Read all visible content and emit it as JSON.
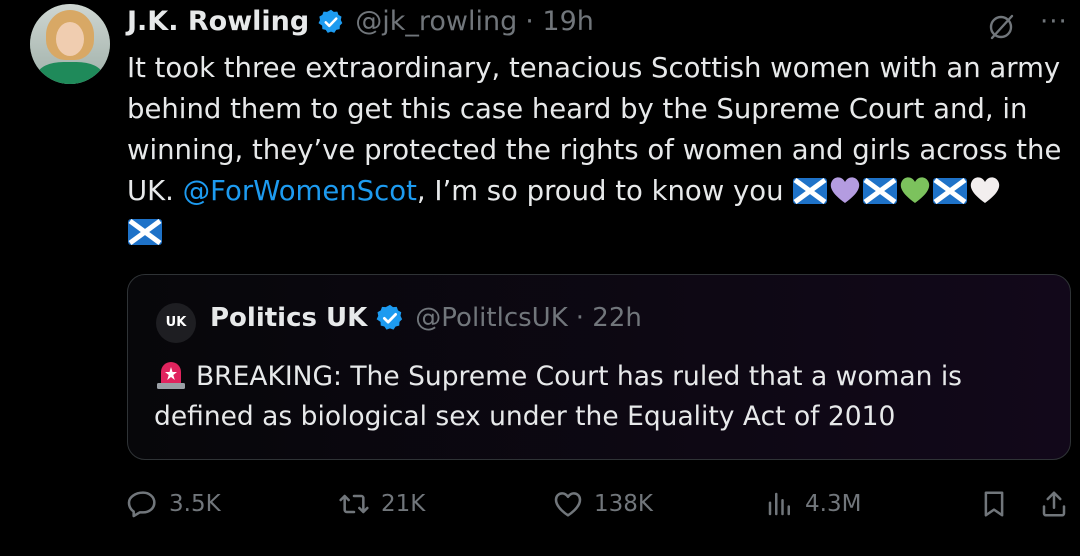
{
  "author": {
    "name": "J.K. Rowling",
    "handle": "@jk_rowling",
    "time": "· 19h",
    "verified_color": "#1d9bf0"
  },
  "tweet": {
    "text_before": "It took three extraordinary, tenacious Scottish women with an army behind them to get this case heard by the Supreme Court and, in winning, they’ve protected the rights of women and girls across the UK. ",
    "mention": "@ForWomenScot",
    "text_after": ", I’m so proud to know you",
    "emojis": [
      "scotland-flag",
      "purple-heart",
      "scotland-flag",
      "green-heart",
      "scotland-flag",
      "white-heart",
      "scotland-flag"
    ]
  },
  "quoted": {
    "avatar_text": "UK",
    "name": "Politics UK",
    "handle": "@PolitlcsUK",
    "time": "· 22h",
    "text": "BREAKING: The Supreme Court has ruled that a woman is defined as biological sex under the Equality Act of 2010"
  },
  "actions": {
    "replies": "3.5K",
    "reposts": "21K",
    "likes": "138K",
    "views": "4.3M"
  },
  "colors": {
    "background": "#000000",
    "text": "#e7e9ea",
    "muted": "#71767b",
    "link": "#1d9bf0",
    "border": "#2f3336"
  },
  "icons": [
    "verified-badge-icon",
    "grok-icon",
    "more-icon",
    "reply-icon",
    "repost-icon",
    "like-icon",
    "views-icon",
    "bookmark-icon",
    "share-icon",
    "siren-icon"
  ]
}
